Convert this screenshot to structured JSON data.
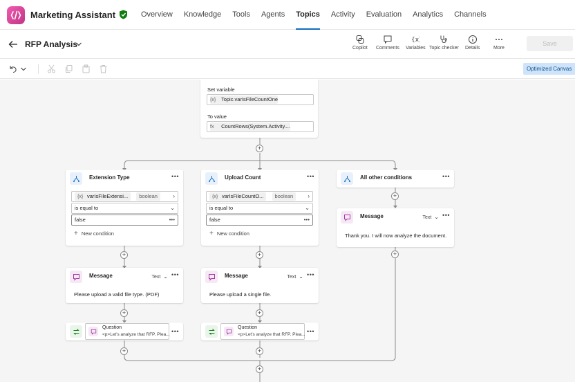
{
  "app": {
    "title": "Marketing Assistant"
  },
  "nav": [
    {
      "label": "Overview",
      "active": false
    },
    {
      "label": "Knowledge",
      "active": false
    },
    {
      "label": "Tools",
      "active": false
    },
    {
      "label": "Agents",
      "active": false
    },
    {
      "label": "Topics",
      "active": true
    },
    {
      "label": "Activity",
      "active": false
    },
    {
      "label": "Evaluation",
      "active": false
    },
    {
      "label": "Analytics",
      "active": false
    },
    {
      "label": "Channels",
      "active": false
    }
  ],
  "toolbar": {
    "page_title": "RFP Analysis",
    "buttons": {
      "copilot": "Copilot",
      "comments": "Comments",
      "variables": "Variables",
      "topic_checker": "Topic checker",
      "details": "Details",
      "more": "More"
    },
    "save_label": "Save"
  },
  "editbar": {
    "optimized_label": "Optimized Canvas"
  },
  "set_variable": {
    "label": "Set variable",
    "variable_value": "Topic.varIsFileCountOne",
    "to_value_label": "To value",
    "to_value": "CountRows(System.Activity...."
  },
  "branches": {
    "extension": {
      "title": "Extension Type",
      "variable": "varIsFileExtensi...",
      "type": "boolean",
      "operator": "is equal to",
      "value": "false",
      "new_condition": "New condition",
      "message_title": "Message",
      "message_type": "Text",
      "message_text": "Please upload a valid file type. (PDF)",
      "question_title": "Question",
      "question_sub": "<p>Let's analyze that RFP. Plea..."
    },
    "upload": {
      "title": "Upload Count",
      "variable": "varIsFileCountO...",
      "type": "boolean",
      "operator": "is equal to",
      "value": "false",
      "new_condition": "New condition",
      "message_title": "Message",
      "message_type": "Text",
      "message_text": "Please upload a single file.",
      "question_title": "Question",
      "question_sub": "<p>Let's analyze that RFP. Plea..."
    },
    "other": {
      "title": "All other conditions",
      "message_title": "Message",
      "message_type": "Text",
      "message_text": "Thank you. I will now analyze the document."
    }
  },
  "colors": {
    "accent": "#0f6cbd",
    "logo": "#e0409c",
    "shield": "#107c10"
  }
}
